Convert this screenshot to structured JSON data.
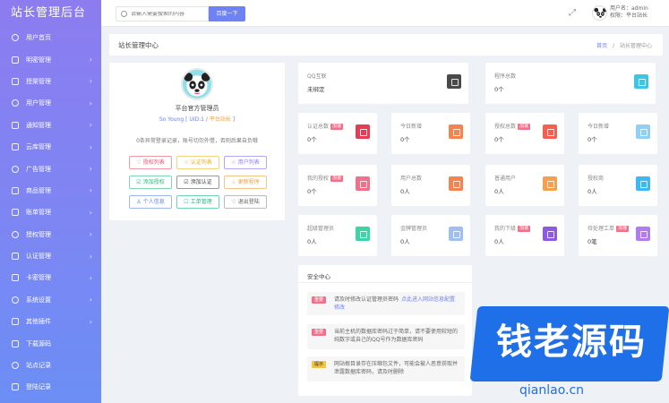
{
  "brand": "站长管理后台",
  "sidebar": {
    "items": [
      {
        "label": "用户首页",
        "arrow": false
      },
      {
        "label": "明密管理",
        "arrow": true
      },
      {
        "label": "授渠管理",
        "arrow": true
      },
      {
        "label": "用户管理",
        "arrow": true
      },
      {
        "label": "通知管理",
        "arrow": true
      },
      {
        "label": "云库管理",
        "arrow": true
      },
      {
        "label": "广告管理",
        "arrow": true
      },
      {
        "label": "商品管理",
        "arrow": true
      },
      {
        "label": "账单管理",
        "arrow": true
      },
      {
        "label": "授权管理",
        "arrow": true
      },
      {
        "label": "认证管理",
        "arrow": true
      },
      {
        "label": "卡密管理",
        "arrow": true
      },
      {
        "label": "系统设置",
        "arrow": true
      },
      {
        "label": "其他插件",
        "arrow": true
      },
      {
        "label": "下载源码",
        "arrow": false
      },
      {
        "label": "站点记录",
        "arrow": false
      },
      {
        "label": "登陆记录",
        "arrow": false
      }
    ]
  },
  "topbar": {
    "search_placeholder": "请输入需要搜索的内容",
    "search_button": "百度一下",
    "user_line1": "用户名：admin",
    "user_line2": "权限：平台站长"
  },
  "crumb": {
    "title": "站长管理中心",
    "home": "首页",
    "sep": "/",
    "current": "站长管理中心"
  },
  "profile": {
    "role": "平台官方管理员",
    "uid": "So Young [ UID:1 /",
    "level": "平台站长",
    "uid_end": "]",
    "note": "0条异常登录记录，账号切勿外借，否则后果自负哦",
    "buttons": [
      {
        "label": "授权列表",
        "icon": "♡",
        "style": "red"
      },
      {
        "label": "认证列表",
        "icon": "☆",
        "style": "yellow"
      },
      {
        "label": "用户列表",
        "icon": "☆",
        "style": "purple"
      },
      {
        "label": "添加授权",
        "icon": "☑",
        "style": "green"
      },
      {
        "label": "添加认证",
        "icon": "☑",
        "style": "dark"
      },
      {
        "label": "更新程序",
        "icon": "♧",
        "style": "orange"
      },
      {
        "label": "个人信息",
        "icon": "♙",
        "style": "blue"
      },
      {
        "label": "工单管理",
        "icon": "☐",
        "style": "teal"
      },
      {
        "label": "退出登陆",
        "icon": "♡",
        "style": "gray"
      }
    ]
  },
  "cards": [
    {
      "title": "QQ互联",
      "value": "未绑定",
      "tag": "",
      "color": "#4a4a4a"
    },
    {
      "title": "程序总数",
      "value": "0个",
      "tag": "",
      "color": "#3cc6e6"
    },
    {
      "title": "认证总数",
      "value": "0个",
      "tag": "加速",
      "color": "#e83b54"
    },
    {
      "title": "今日新增",
      "value": "0个",
      "tag": "",
      "color": "#f5834f"
    },
    {
      "title": "授权总数",
      "value": "0个",
      "tag": "加速",
      "color": "#f55f4f"
    },
    {
      "title": "今日新增",
      "value": "0个",
      "tag": "",
      "color": "#8fd0f4"
    },
    {
      "title": "我的授权",
      "value": "0个",
      "tag": "加速",
      "color": "#f2708a"
    },
    {
      "title": "用户总数",
      "value": "0人",
      "tag": "",
      "color": "#f5834f"
    },
    {
      "title": "普通用户",
      "value": "0人",
      "tag": "",
      "color": "#f5a04f"
    },
    {
      "title": "授权商",
      "value": "0人",
      "tag": "",
      "color": "#3db8f0"
    },
    {
      "title": "超级管理员",
      "value": "0人",
      "tag": "",
      "color": "#3cd6a4"
    },
    {
      "title": "金牌管理员",
      "value": "0人",
      "tag": "",
      "color": "#9fbff4"
    },
    {
      "title": "我的下级",
      "value": "0人",
      "tag": "加速",
      "color": "#8c5ce0"
    },
    {
      "title": "待处理工单",
      "value": "0笔",
      "tag": "加速",
      "color": "#b07cf0"
    }
  ],
  "security": {
    "title": "安全中心",
    "items": [
      {
        "tag": "重要",
        "tag_style": "danger",
        "text": "请及时修改认证管理员密码",
        "link": "点此进入网站信息配置修改"
      },
      {
        "tag": "重要",
        "tag_style": "danger",
        "text": "当前主机的数据库密码过于简单，请不要使用较短的纯数字或自己的QQ号作为数据库密码",
        "link": ""
      },
      {
        "tag": "提示",
        "tag_style": "warn",
        "text": "网站根目录存在压缩包文件，可能会被人恶意获取并泄露数据库密码，请及时删除",
        "link": ""
      }
    ]
  },
  "watermark": {
    "text": "钱老源码",
    "url": "qianlao.cn"
  }
}
